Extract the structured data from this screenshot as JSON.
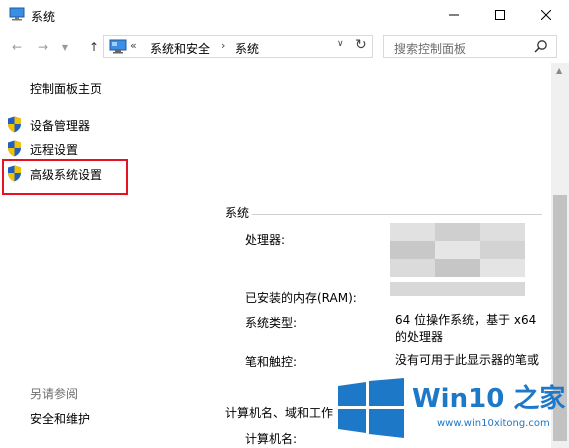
{
  "window": {
    "title": "系统"
  },
  "navigation": {
    "breadcrumb_root_glyph": "«",
    "breadcrumbs": [
      "系统和安全",
      "系统"
    ],
    "search_placeholder": "搜索控制面板"
  },
  "sidebar": {
    "home_link": "控制面板主页",
    "items": [
      {
        "label": "设备管理器",
        "icon": "shield-icon"
      },
      {
        "label": "远程设置",
        "icon": "shield-icon"
      },
      {
        "label": "高级系统设置",
        "icon": "shield-icon",
        "highlighted": true
      }
    ],
    "see_also_heading": "另请参阅",
    "see_also_links": [
      "安全和维护"
    ]
  },
  "content": {
    "system_section_title": "系统",
    "rows": [
      {
        "label": "处理器:",
        "value": ""
      },
      {
        "label": "已安装的内存(RAM):",
        "value": ""
      },
      {
        "label": "系统类型:",
        "value_line1": "64 位操作系统，基于 x64",
        "value_line2": "的处理器"
      },
      {
        "label": "笔和触控:",
        "value": "没有可用于此显示器的笔或"
      }
    ],
    "computer_section_title": "计算机名、域和工作",
    "computer_name_label": "计算机名:"
  },
  "watermark": {
    "brand": "Win10 之家",
    "url": "www.win10xitong.com"
  },
  "colors": {
    "highlight_box": "#e81123",
    "shield_blue": "#1f5fbf",
    "shield_yellow": "#f2c200",
    "watermark_blue": "#1e78c8",
    "redacted_gray": "#d3d3d3"
  }
}
